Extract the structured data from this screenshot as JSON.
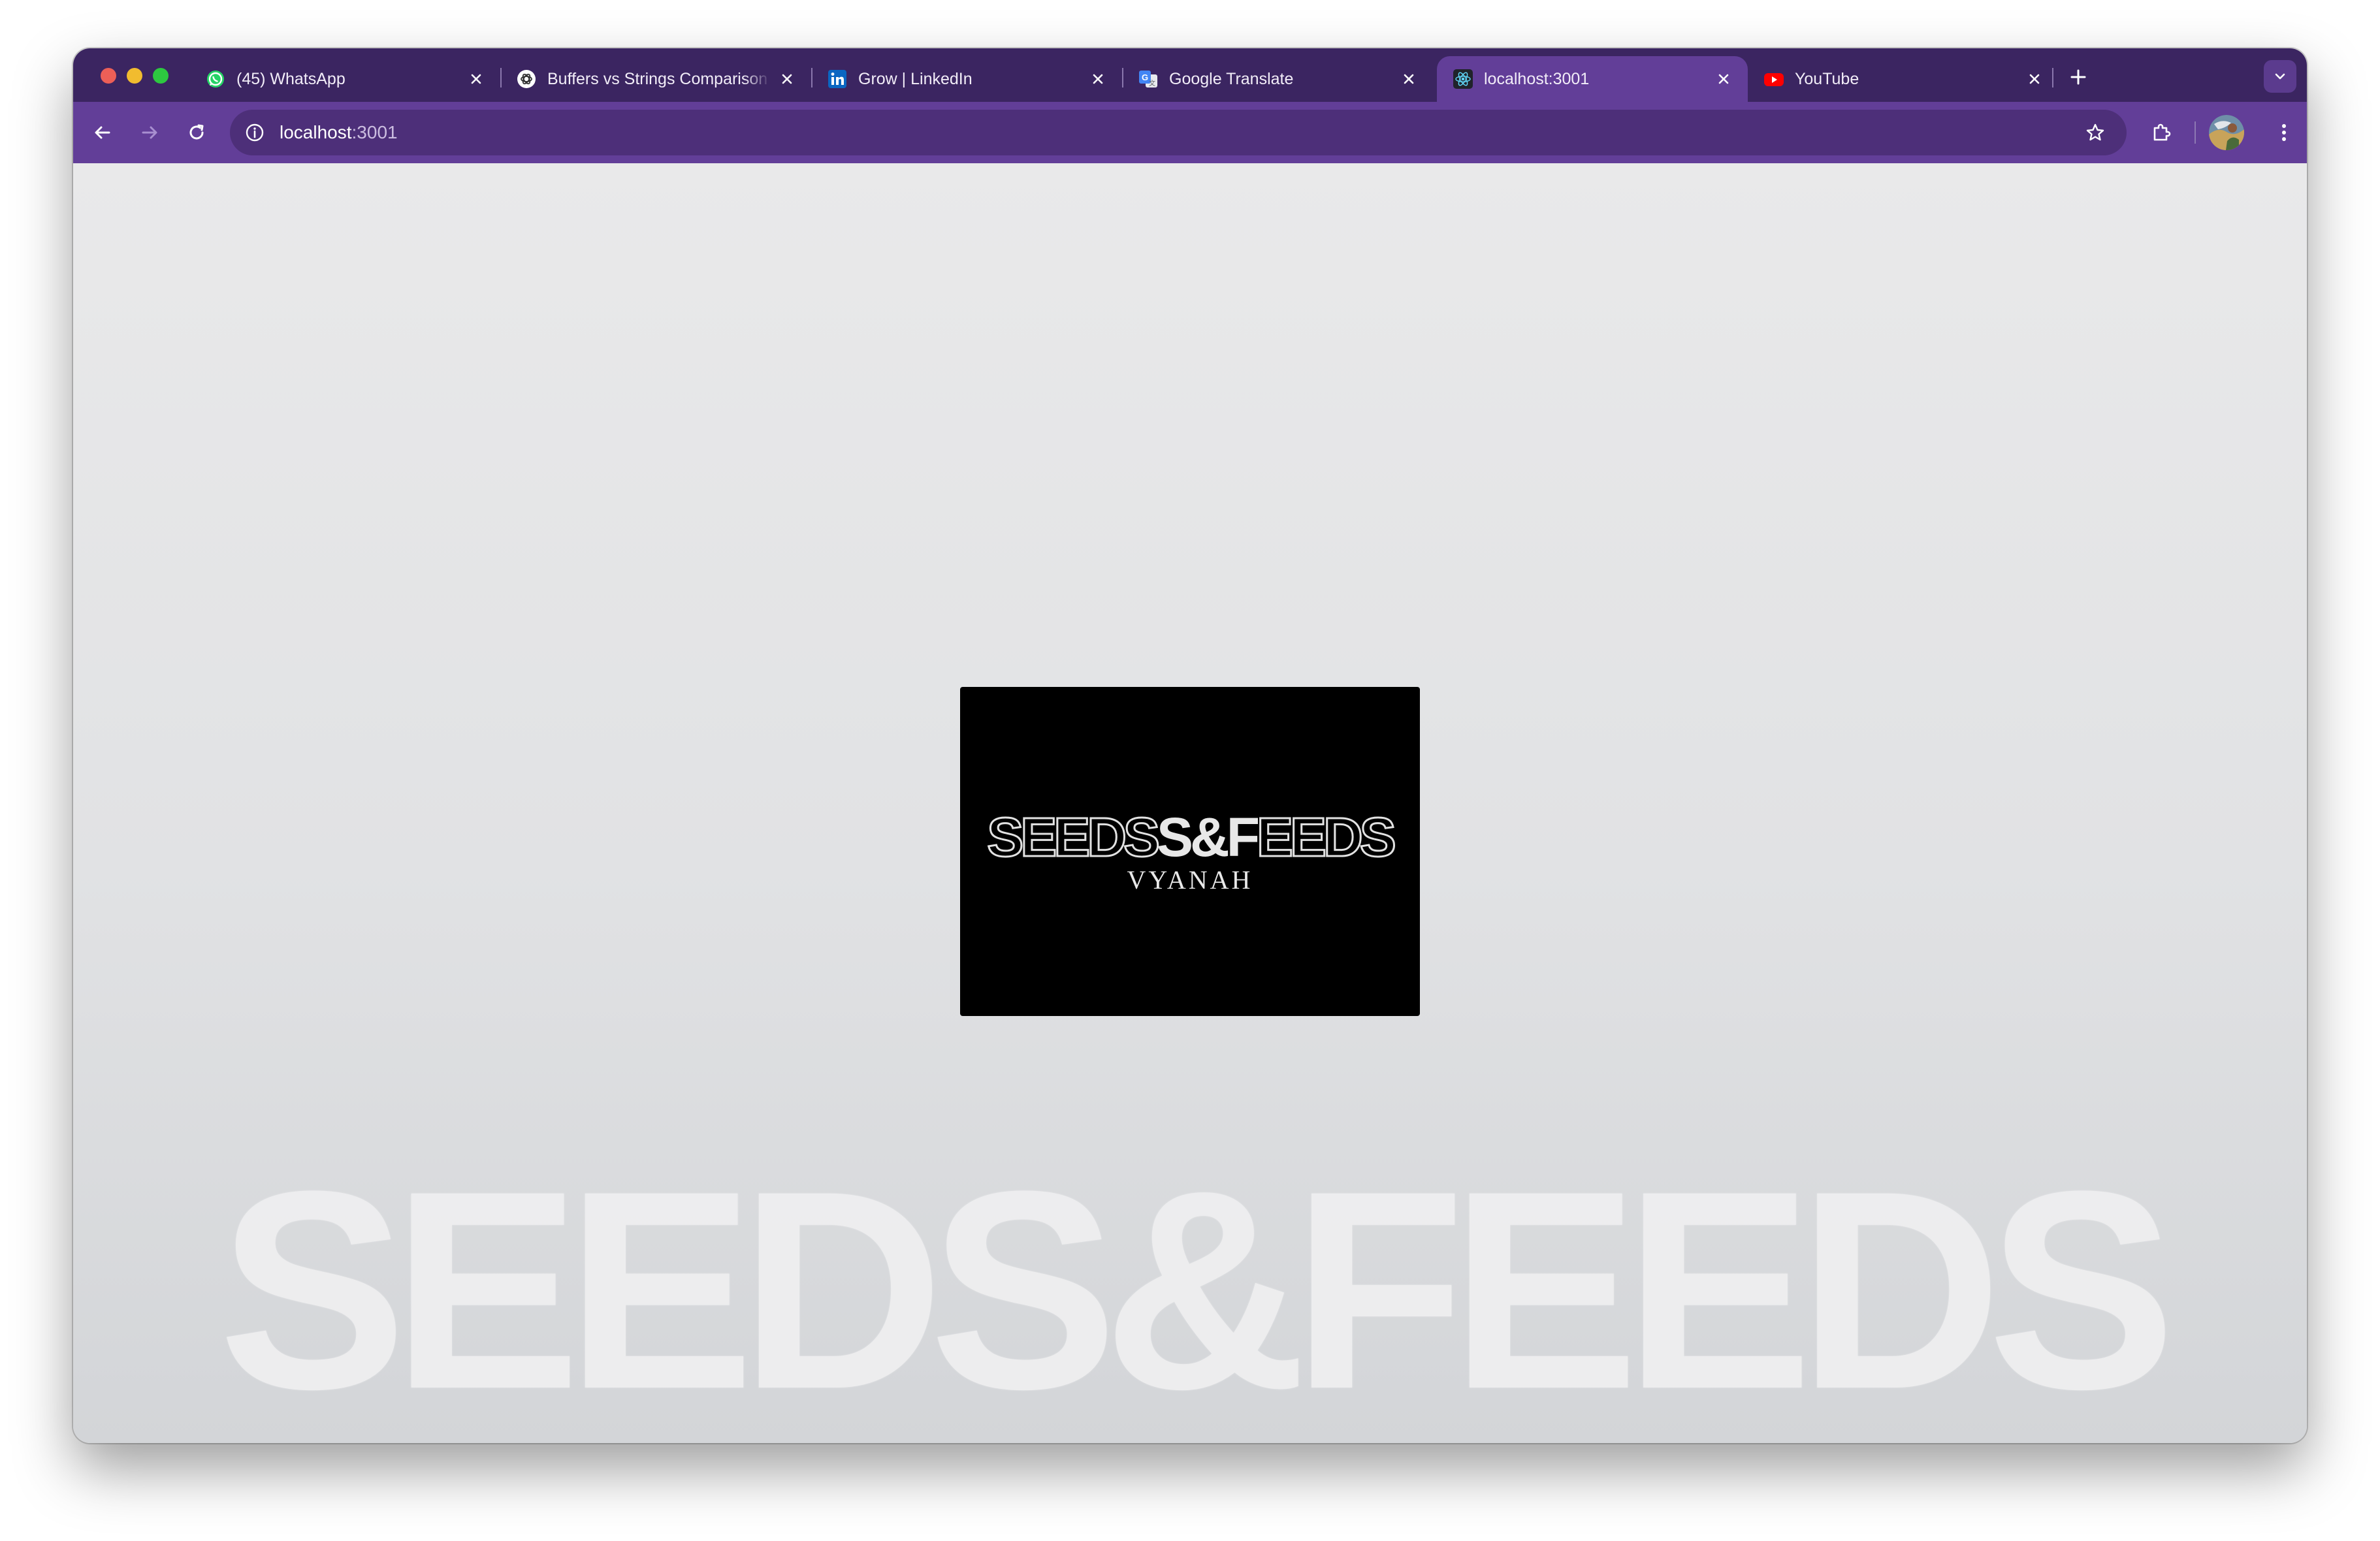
{
  "browser": {
    "tabs": [
      {
        "title": "(45) WhatsApp",
        "icon": "whatsapp-icon",
        "active": false
      },
      {
        "title": "Buffers vs Strings Comparison",
        "icon": "openai-icon",
        "active": false
      },
      {
        "title": "Grow | LinkedIn",
        "icon": "linkedin-icon",
        "active": false
      },
      {
        "title": "Google Translate",
        "icon": "google-translate-icon",
        "active": false
      },
      {
        "title": "localhost:3001",
        "icon": "react-icon",
        "active": true
      },
      {
        "title": "YouTube",
        "icon": "youtube-icon",
        "active": false
      }
    ],
    "address_bar": {
      "host": "localhost",
      "port": ":3001"
    },
    "colors": {
      "tabstrip": "#3b2561",
      "toolbar": "#623e98",
      "omnibox": "#4d2f79"
    }
  },
  "page": {
    "logo": {
      "brand_thin_1": "SEEDS",
      "brand_solid_1": "S&F",
      "brand_thin_2": "EEDS",
      "subtitle": "VYANAH"
    },
    "watermark": "SEEDS&FEEDS"
  }
}
